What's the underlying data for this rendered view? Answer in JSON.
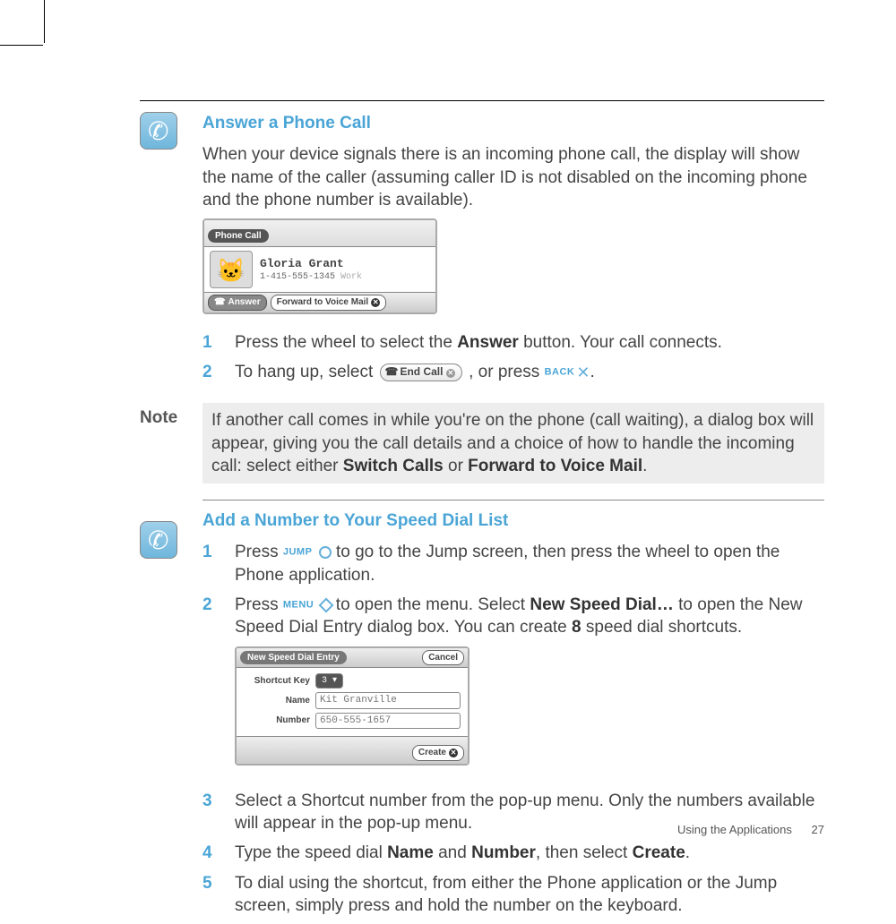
{
  "section1": {
    "heading": "Answer a Phone Call",
    "intro": "When your device signals there is an incoming phone call, the display will show the name of the caller (assuming caller ID is not disabled on the incoming phone and the phone number is available).",
    "shot": {
      "tab": "Phone Call",
      "name": "Gloria Grant",
      "num": "1-415-555-1345",
      "tag": "Work",
      "answer": "Answer",
      "fwd": "Forward to Voice Mail"
    },
    "s1_pre": "Press the wheel to select the ",
    "s1_b": "Answer",
    "s1_post": " button. Your call connects.",
    "s2_pre": "To hang up, select ",
    "endcall": "End Call",
    "s2_mid": " , or press ",
    "back": "BACK",
    "s2_dot": "."
  },
  "note": {
    "label": "Note",
    "t1": "If another call comes in while you're on the phone (call waiting), a dialog box will appear, giving you the call details and a choice of how to handle the incoming call: select either ",
    "b1": "Switch Calls",
    "or": " or ",
    "b2": "Forward to Voice Mail",
    "dot": "."
  },
  "section2": {
    "heading": "Add a Number to Your Speed Dial List",
    "s1_a": "Press ",
    "jump": "JUMP",
    "s1_b": " to go to the Jump screen, then press the wheel to open the Phone application.",
    "s2_a": "Press ",
    "menu": "MENU",
    "s2_b": " to open the menu. Select ",
    "s2_c": "New Speed Dial…",
    "s2_d": " to open the New Speed Dial Entry dialog box. You can create ",
    "s2_e": "8",
    "s2_f": " speed dial shortcuts.",
    "shot": {
      "title": "New Speed Dial Entry",
      "cancel": "Cancel",
      "lbl_key": "Shortcut Key",
      "key": "3",
      "lbl_name": "Name",
      "name": "Kit Granville",
      "lbl_num": "Number",
      "num": "650-555-1657",
      "create": "Create"
    },
    "s3": "Select a Shortcut number from the pop-up menu. Only the numbers available will appear in the pop-up menu.",
    "s4_a": "Type the speed dial ",
    "s4_b": "Name",
    "s4_c": " and ",
    "s4_d": "Number",
    "s4_e": ", then select ",
    "s4_f": "Create",
    "s4_g": ".",
    "s5": "To dial using the shortcut, from either the Phone application or the Jump screen, simply press and hold the number on the keyboard."
  },
  "nums": {
    "n1": "1",
    "n2": "2",
    "n3": "3",
    "n4": "4",
    "n5": "5"
  },
  "footer": {
    "section": "Using the Applications",
    "page": "27"
  }
}
